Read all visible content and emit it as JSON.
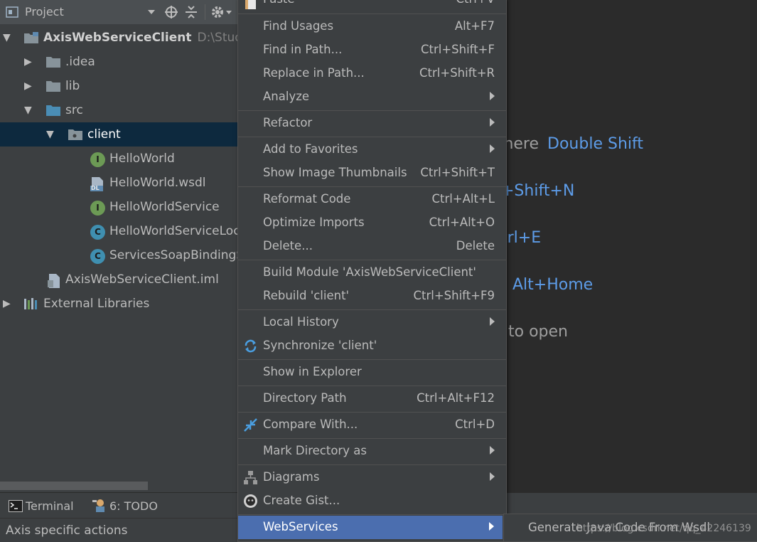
{
  "project_panel": {
    "title": "Project",
    "tree": [
      {
        "label": "AxisWebServiceClient",
        "path": "D:\\Stude",
        "expanded": true
      },
      {
        "label": ".idea",
        "expanded": false
      },
      {
        "label": "lib",
        "expanded": false
      },
      {
        "label": "src",
        "expanded": true
      },
      {
        "label": "client",
        "expanded": true,
        "selected": true
      },
      {
        "label": "HelloWorld",
        "badge": "I"
      },
      {
        "label": "HelloWorld.wsdl",
        "badge": "DL"
      },
      {
        "label": "HelloWorldService",
        "badge": "I"
      },
      {
        "label": "HelloWorldServiceLoca",
        "badge": "C"
      },
      {
        "label": "ServicesSoapBindingS",
        "badge": "C"
      },
      {
        "label": "AxisWebServiceClient.iml"
      },
      {
        "label": "External Libraries",
        "expanded": false
      }
    ]
  },
  "editor_hints": [
    {
      "grey": "here",
      "blue": "Double Shift"
    },
    {
      "grey": "",
      "blue": "+Shift+N"
    },
    {
      "grey": "",
      "blue": "trl+E"
    },
    {
      "grey": "",
      "blue": "Alt+Home"
    },
    {
      "grey": "to open",
      "blue": ""
    }
  ],
  "context_menu": {
    "items": [
      {
        "label": "Paste",
        "shortcut": "Ctrl+V"
      },
      {
        "label": "Find Usages",
        "shortcut": "Alt+F7"
      },
      {
        "label": "Find in Path...",
        "shortcut": "Ctrl+Shift+F"
      },
      {
        "label": "Replace in Path...",
        "shortcut": "Ctrl+Shift+R"
      },
      {
        "label": "Analyze",
        "submenu": true
      },
      {
        "label": "Refactor",
        "submenu": true
      },
      {
        "label": "Add to Favorites",
        "submenu": true
      },
      {
        "label": "Show Image Thumbnails",
        "shortcut": "Ctrl+Shift+T"
      },
      {
        "label": "Reformat Code",
        "shortcut": "Ctrl+Alt+L"
      },
      {
        "label": "Optimize Imports",
        "shortcut": "Ctrl+Alt+O"
      },
      {
        "label": "Delete...",
        "shortcut": "Delete"
      },
      {
        "label": "Build Module 'AxisWebServiceClient'",
        "shortcut": ""
      },
      {
        "label": "Rebuild 'client'",
        "shortcut": "Ctrl+Shift+F9"
      },
      {
        "label": "Local History",
        "submenu": true
      },
      {
        "label": "Synchronize 'client'",
        "shortcut": ""
      },
      {
        "label": "Show in Explorer",
        "shortcut": ""
      },
      {
        "label": "Directory Path",
        "shortcut": "Ctrl+Alt+F12"
      },
      {
        "label": "Compare With...",
        "shortcut": "Ctrl+D"
      },
      {
        "label": "Mark Directory as",
        "submenu": true
      },
      {
        "label": "Diagrams",
        "submenu": true
      },
      {
        "label": "Create Gist...",
        "shortcut": ""
      },
      {
        "label": "WebServices",
        "submenu": true,
        "selected": true
      }
    ]
  },
  "submenu": {
    "items": [
      {
        "label": "Generate Java Code From Wsdl"
      }
    ],
    "watermark": "https://blog.csdn.net/qq_42246139"
  },
  "bottom_tabs": [
    {
      "label": "Terminal"
    },
    {
      "label": "6: TODO"
    }
  ],
  "status_bar": {
    "text": "Axis specific actions"
  },
  "colors": {
    "panel_bg": "#3c3f41",
    "editor_bg": "#2b2b2b",
    "selection": "#4b6eaf",
    "tree_selection": "#0d293e",
    "hint_blue": "#5d9ce8"
  }
}
